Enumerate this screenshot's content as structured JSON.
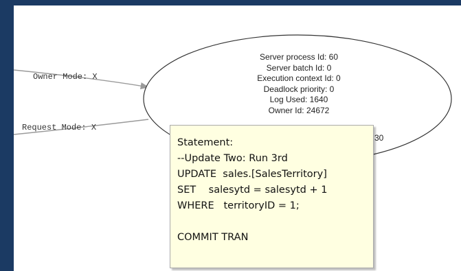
{
  "graph": {
    "edges": [
      {
        "label": "Owner Mode: X"
      },
      {
        "label": "Request Mode: X"
      }
    ],
    "process_node": {
      "lines": [
        "Server process Id: 60",
        "Server batch Id: 0",
        "Execution context Id: 0",
        "Deadlock priority: 0",
        "Log Used: 1640",
        "Owner Id: 24672"
      ],
      "partial_text": "30"
    }
  },
  "tooltip": {
    "lines": [
      "Statement:",
      "--Update Two: Run 3rd",
      "UPDATE  sales.[SalesTerritory]",
      "SET    salesytd = salesytd + 1",
      "WHERE   territoryID = 1;",
      "",
      "COMMIT TRAN"
    ]
  }
}
